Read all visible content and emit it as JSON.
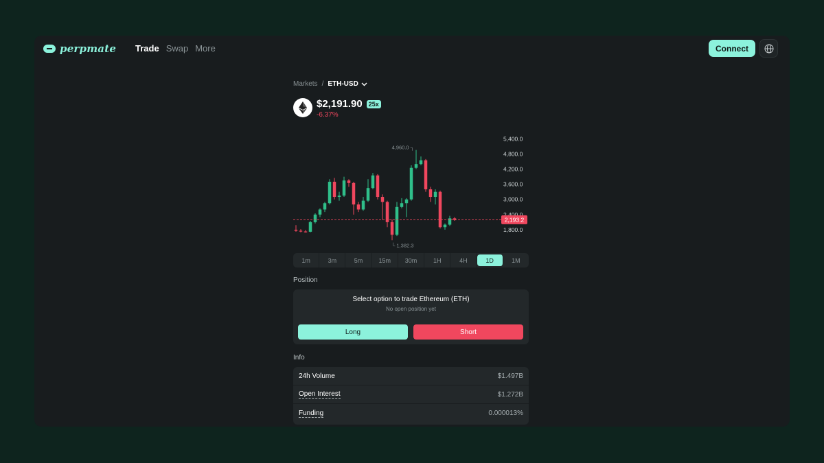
{
  "header": {
    "logo_text": "perpmate",
    "nav": [
      {
        "label": "Trade",
        "active": true
      },
      {
        "label": "Swap",
        "active": false
      },
      {
        "label": "More",
        "active": false
      }
    ],
    "connect_label": "Connect",
    "language_icon": "globe-icon"
  },
  "market": {
    "breadcrumb_root": "Markets",
    "breadcrumb_sep": "/",
    "pair": "ETH-USD",
    "price": "$2,191.90",
    "leverage": "25x",
    "change": "-6.37%",
    "asset_icon": "ethereum-icon"
  },
  "chart_data": {
    "type": "candlestick",
    "y_ticks": [
      "5,400.0",
      "4,800.0",
      "4,200.0",
      "3,600.0",
      "3,000.0",
      "2,400.0",
      "1,800.0"
    ],
    "ylim": [
      1200,
      5600
    ],
    "high_label": "4,960.0",
    "low_label": "1,382.3",
    "last_price_label": "2,193.2",
    "last_price": 2193.2,
    "candles": [
      {
        "o": 1800,
        "h": 1980,
        "l": 1720,
        "c": 1760
      },
      {
        "o": 1760,
        "h": 1820,
        "l": 1700,
        "c": 1730
      },
      {
        "o": 1730,
        "h": 1790,
        "l": 1690,
        "c": 1720
      },
      {
        "o": 1720,
        "h": 2150,
        "l": 1700,
        "c": 2100
      },
      {
        "o": 2100,
        "h": 2450,
        "l": 2050,
        "c": 2400
      },
      {
        "o": 2400,
        "h": 2650,
        "l": 2300,
        "c": 2600
      },
      {
        "o": 2600,
        "h": 2900,
        "l": 2500,
        "c": 2850
      },
      {
        "o": 2850,
        "h": 3800,
        "l": 2800,
        "c": 3700
      },
      {
        "o": 3700,
        "h": 3850,
        "l": 3000,
        "c": 3100
      },
      {
        "o": 3100,
        "h": 3300,
        "l": 2950,
        "c": 3150
      },
      {
        "o": 3150,
        "h": 3900,
        "l": 3100,
        "c": 3750
      },
      {
        "o": 3750,
        "h": 3800,
        "l": 3500,
        "c": 3650
      },
      {
        "o": 3650,
        "h": 3700,
        "l": 2400,
        "c": 2800
      },
      {
        "o": 2800,
        "h": 2900,
        "l": 2500,
        "c": 2600
      },
      {
        "o": 2600,
        "h": 3100,
        "l": 2550,
        "c": 2950
      },
      {
        "o": 2950,
        "h": 3800,
        "l": 2900,
        "c": 3450
      },
      {
        "o": 3450,
        "h": 4050,
        "l": 3400,
        "c": 3950
      },
      {
        "o": 3950,
        "h": 4000,
        "l": 3000,
        "c": 3100
      },
      {
        "o": 3100,
        "h": 3200,
        "l": 2200,
        "c": 2900
      },
      {
        "o": 2900,
        "h": 2950,
        "l": 1900,
        "c": 2100
      },
      {
        "o": 2100,
        "h": 2200,
        "l": 1382,
        "c": 1600
      },
      {
        "o": 1600,
        "h": 2900,
        "l": 1550,
        "c": 2700
      },
      {
        "o": 2700,
        "h": 3050,
        "l": 2650,
        "c": 2850
      },
      {
        "o": 2850,
        "h": 3050,
        "l": 2300,
        "c": 3000
      },
      {
        "o": 3000,
        "h": 4350,
        "l": 2950,
        "c": 4250
      },
      {
        "o": 4250,
        "h": 4960,
        "l": 4200,
        "c": 4400
      },
      {
        "o": 4400,
        "h": 4700,
        "l": 4350,
        "c": 4550
      },
      {
        "o": 4550,
        "h": 4600,
        "l": 3300,
        "c": 3400
      },
      {
        "o": 3400,
        "h": 3500,
        "l": 2900,
        "c": 3100
      },
      {
        "o": 3100,
        "h": 3400,
        "l": 2800,
        "c": 3300
      },
      {
        "o": 3300,
        "h": 3350,
        "l": 1850,
        "c": 1900
      },
      {
        "o": 1900,
        "h": 2050,
        "l": 1800,
        "c": 2000
      },
      {
        "o": 2000,
        "h": 2350,
        "l": 1950,
        "c": 2250
      },
      {
        "o": 2250,
        "h": 2300,
        "l": 2150,
        "c": 2193
      }
    ],
    "colors": {
      "up": "#2fbf8a",
      "down": "#f0475e",
      "axis": "#c9cfd1",
      "muted": "#8a9396"
    }
  },
  "timeframes": {
    "options": [
      "1m",
      "3m",
      "5m",
      "15m",
      "30m",
      "1H",
      "4H",
      "1D",
      "1M"
    ],
    "active": "1D"
  },
  "position": {
    "label": "Position",
    "title": "Select option to trade Ethereum (ETH)",
    "subtitle": "No open position yet",
    "long_label": "Long",
    "short_label": "Short"
  },
  "info": {
    "label": "Info",
    "rows": [
      {
        "key": "24h Volume",
        "value": "$1.497B"
      },
      {
        "key": "Open Interest",
        "value": "$1.272B"
      },
      {
        "key": "Funding",
        "value": "0.000013%"
      }
    ]
  },
  "colors": {
    "accent": "#8cf2dc",
    "negative": "#f0475e",
    "background": "#0e241e",
    "panel": "#181c1e"
  }
}
